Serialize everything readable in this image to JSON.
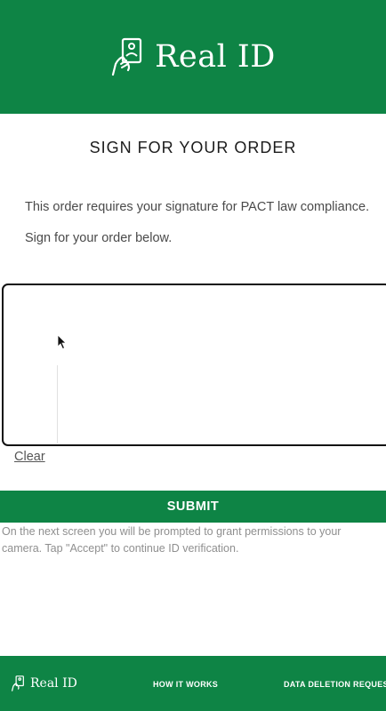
{
  "brand": {
    "name": "Real ID",
    "logo_icon": "id-card-hand-icon"
  },
  "page": {
    "title": "SIGN FOR YOUR ORDER",
    "description_1": "This order requires your signature for PACT law compliance.",
    "description_2": "Sign for your order below."
  },
  "signature_pad": {
    "clear_label": "Clear"
  },
  "submit": {
    "label": "SUBMIT",
    "note": "On the next screen you will be prompted to grant permissions to your camera. Tap \"Accept\" to continue ID verification."
  },
  "footer": {
    "brand": "Real ID",
    "links": [
      "HOW IT WORKS",
      "DATA DELETION REQUESTS"
    ]
  },
  "colors": {
    "brand_green": "#0e8445",
    "text": "#4a4a4a",
    "muted": "#8f8f8f"
  }
}
